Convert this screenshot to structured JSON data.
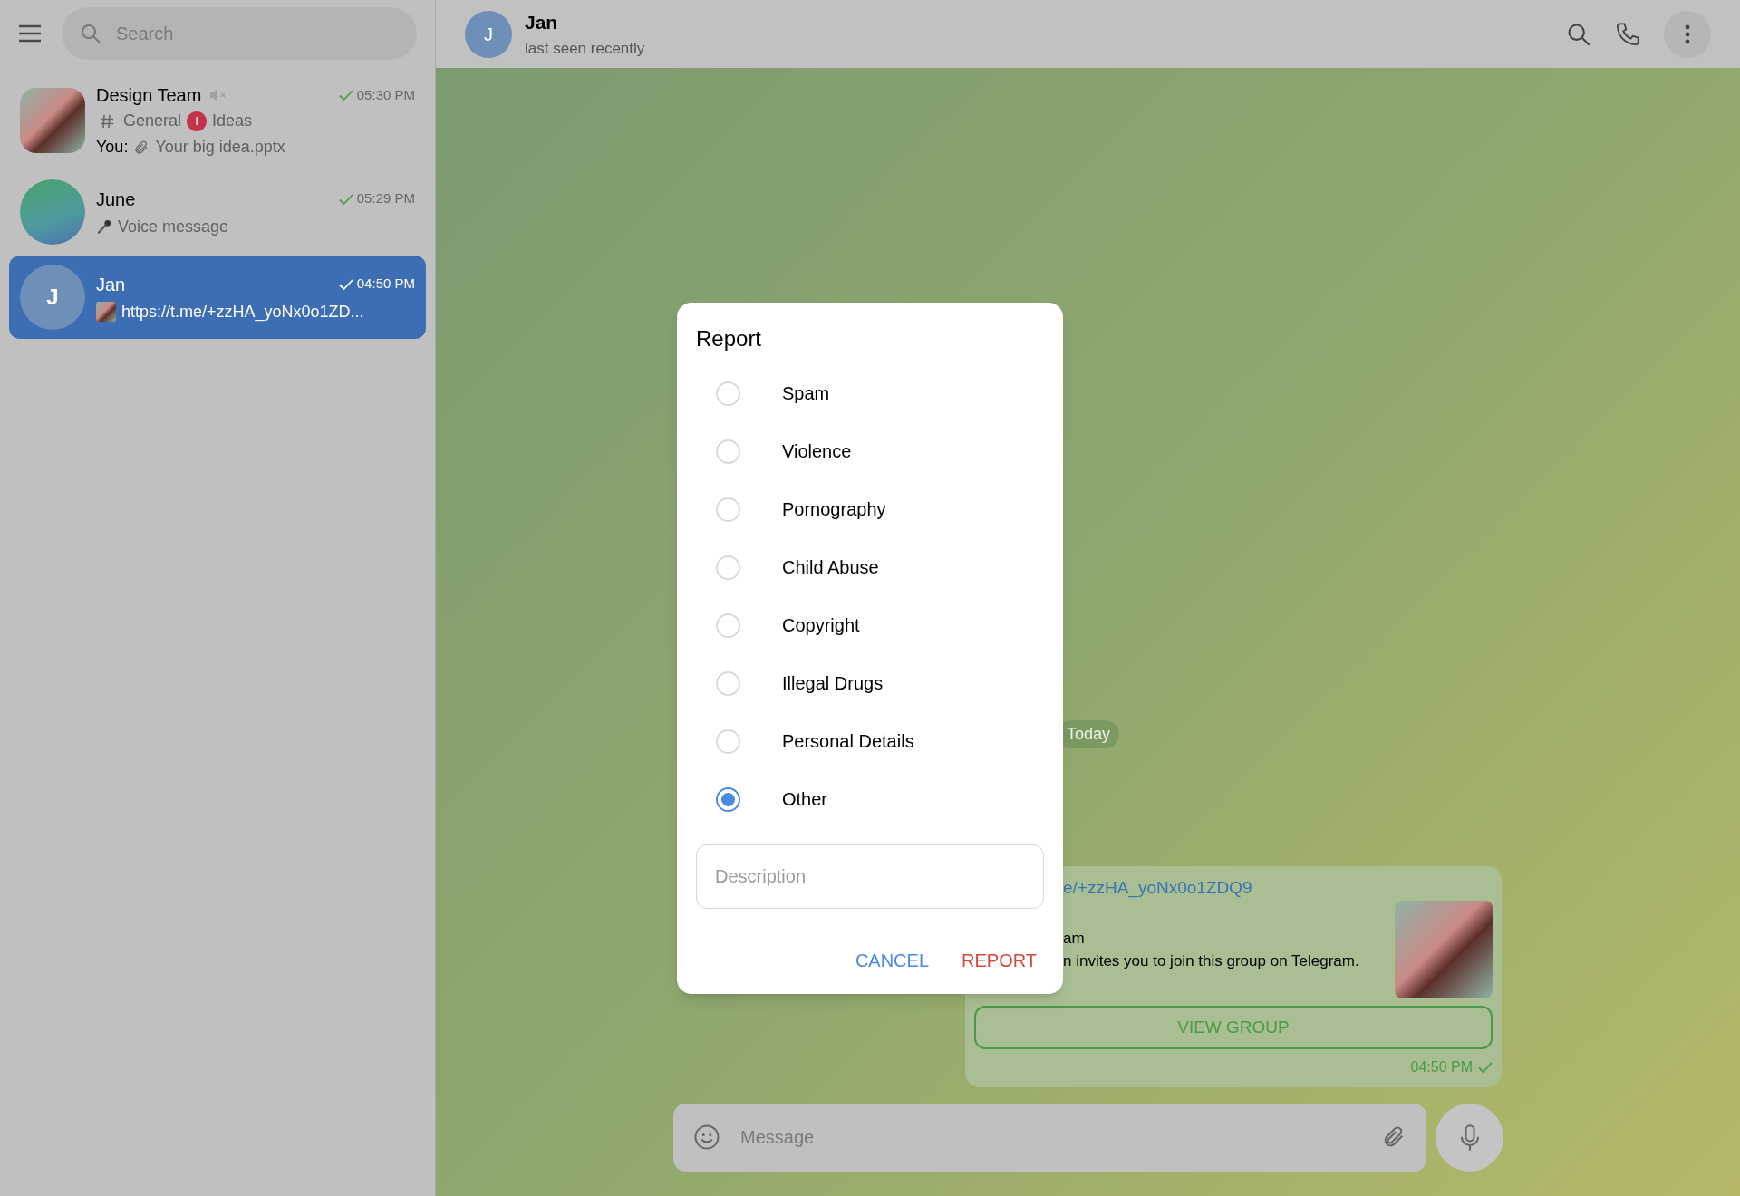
{
  "sidebar": {
    "search": {
      "placeholder": "Search"
    },
    "chats": [
      {
        "name": "Design Team",
        "avatar": {
          "kind": "photo"
        },
        "muted": true,
        "time": "05:30 PM",
        "selected": false,
        "topics": [
          {
            "kind": "hash",
            "label": "General"
          },
          {
            "kind": "letter",
            "letter": "I",
            "label": "Ideas"
          }
        ],
        "sender": "You:",
        "preview": {
          "kind": "paperclip",
          "text": "Your big idea.pptx"
        }
      },
      {
        "name": "June",
        "avatar": {
          "kind": "sticker"
        },
        "muted": false,
        "time": "05:29 PM",
        "selected": false,
        "preview": {
          "kind": "microphone",
          "text": "Voice message"
        }
      },
      {
        "name": "Jan",
        "avatar": {
          "kind": "initial",
          "letter": "J"
        },
        "muted": false,
        "time": "04:50 PM",
        "selected": true,
        "preview": {
          "kind": "thumbnail",
          "text": "https://t.me/+zzHA_yoNx0o1ZD..."
        }
      }
    ]
  },
  "header": {
    "avatar_letter": "J",
    "name": "Jan",
    "status": "last seen recently"
  },
  "chat": {
    "date": "Today",
    "message": {
      "link": "e/+zzHA_yoNx0o1ZDQ9",
      "title": "am",
      "description": "n invites you to join this group on Telegram.",
      "button": "VIEW GROUP",
      "time": "04:50 PM"
    },
    "composer": {
      "placeholder": "Message"
    }
  },
  "dialog": {
    "title": "Report",
    "options": [
      {
        "label": "Spam",
        "selected": false
      },
      {
        "label": "Violence",
        "selected": false
      },
      {
        "label": "Pornography",
        "selected": false
      },
      {
        "label": "Child Abuse",
        "selected": false
      },
      {
        "label": "Copyright",
        "selected": false
      },
      {
        "label": "Illegal Drugs",
        "selected": false
      },
      {
        "label": "Personal Details",
        "selected": false
      },
      {
        "label": "Other",
        "selected": true
      }
    ],
    "description": {
      "placeholder": "Description"
    },
    "buttons": [
      {
        "kind": "cancel",
        "label": "CANCEL"
      },
      {
        "kind": "confirm",
        "label": "REPORT"
      }
    ]
  }
}
